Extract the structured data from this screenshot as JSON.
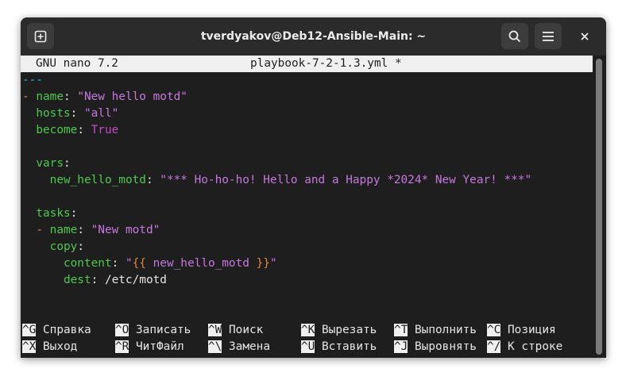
{
  "window": {
    "title": "tverdyakov@Deb12-Ansible-Main: ~"
  },
  "icons": {
    "new_tab": "plus-in-square-icon",
    "search": "search-icon",
    "menu": "hamburger-menu-icon",
    "close": "close-icon"
  },
  "nano": {
    "version": "GNU nano 7.2",
    "filename": "playbook-7-2-1.3.yml *"
  },
  "editor_lines": [
    {
      "doc_start": "---"
    },
    {
      "dash": "- ",
      "key": "name",
      "colon": ": ",
      "value": "\"New hello motd\""
    },
    {
      "indent": "  ",
      "key": "hosts",
      "colon": ": ",
      "value": "\"all\""
    },
    {
      "indent": "  ",
      "key": "become",
      "colon": ": ",
      "value": "True"
    },
    {
      "empty": ""
    },
    {
      "indent": "  ",
      "key": "vars",
      "colon": ":"
    },
    {
      "indent": "    ",
      "key": "new_hello_motd",
      "colon": ": ",
      "value": "\"*** Ho-ho-ho! Hello and a Happy *2024* New Year! ***\""
    },
    {
      "empty": ""
    },
    {
      "indent": "  ",
      "key": "tasks",
      "colon": ":"
    },
    {
      "indent": "  ",
      "dash": "- ",
      "key": "name",
      "colon": ": ",
      "value": "\"New motd\""
    },
    {
      "indent": "    ",
      "key": "copy",
      "colon": ":"
    },
    {
      "indent": "      ",
      "key": "content",
      "colon": ": ",
      "value_q1": "\"",
      "value_tpl_open": "{{",
      "value_var": " new_hello_motd ",
      "value_tpl_close": "}}",
      "value_q2": "\""
    },
    {
      "indent": "      ",
      "key": "dest",
      "colon": ": ",
      "value": "/etc/motd"
    }
  ],
  "shortcuts": [
    [
      {
        "key": "^G",
        "label": "Справка"
      },
      {
        "key": "^O",
        "label": "Записать"
      },
      {
        "key": "^W",
        "label": "Поиск"
      },
      {
        "key": "^K",
        "label": "Вырезать"
      },
      {
        "key": "^T",
        "label": "Выполнить"
      },
      {
        "key": "^C",
        "label": "Позиция"
      }
    ],
    [
      {
        "key": "^X",
        "label": "Выход"
      },
      {
        "key": "^R",
        "label": "ЧитФайл"
      },
      {
        "key": "^\\",
        "label": "Замена"
      },
      {
        "key": "^U",
        "label": "Вставить"
      },
      {
        "key": "^J",
        "label": "Выровнять"
      },
      {
        "key": "^/",
        "label": "К строке"
      }
    ]
  ],
  "colors": {
    "key": "#4ec94e",
    "string": "#c678dd",
    "template": "#e0883a",
    "doc_start": "#35b5d5",
    "background": "#1e1e1e"
  }
}
